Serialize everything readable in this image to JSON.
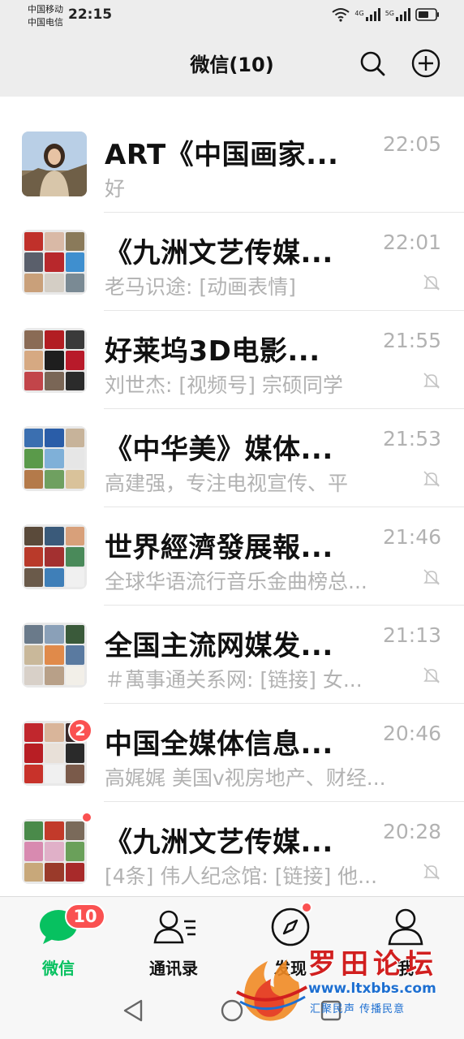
{
  "status_bar": {
    "carrier_1": "中国移动",
    "carrier_2": "中国电信",
    "time": "22:15",
    "network_1": "4G",
    "network_2": "5G"
  },
  "header": {
    "title": "微信(10)"
  },
  "chats": [
    {
      "name": "ART《中国画家...",
      "time": "22:05",
      "preview": "好",
      "muted": false
    },
    {
      "name": "《九洲文艺传媒...",
      "time": "22:01",
      "preview": "老马识途: [动画表情]",
      "muted": true
    },
    {
      "name": "好莱坞3D电影...",
      "time": "21:55",
      "preview": "刘世杰: [视频号] 宗硕同学",
      "muted": true
    },
    {
      "name": "《中华美》媒体...",
      "time": "21:53",
      "preview": "高建强，专注电视宣传、平",
      "muted": true
    },
    {
      "name": "世界經濟發展報...",
      "time": "21:46",
      "preview": "全球华语流行音乐金曲榜总...",
      "muted": true
    },
    {
      "name": "全国主流网媒发...",
      "time": "21:13",
      "preview": "＃萬事通关系网: [链接] 女...",
      "muted": true
    },
    {
      "name": "中国全媒体信息...",
      "time": "20:46",
      "preview": "高娓娓 美国v视房地产、财经...",
      "muted": false,
      "badge": "2"
    },
    {
      "name": "《九洲文艺传媒...",
      "time": "20:28",
      "preview": "[4条] 伟人纪念馆: [链接] 他...",
      "muted": true
    }
  ],
  "tabs": [
    {
      "label": "微信",
      "badge": "10"
    },
    {
      "label": "通讯录"
    },
    {
      "label": "发现"
    },
    {
      "label": "我"
    }
  ],
  "watermark": {
    "title": "罗田论坛",
    "url": "www.ltxbbs.com",
    "slogan": "汇聚民声  传播民意"
  },
  "colors": {
    "accent": "#07c160",
    "badge": "#fa5151",
    "background": "#ededed",
    "secondary_text": "#b2b2b2"
  }
}
